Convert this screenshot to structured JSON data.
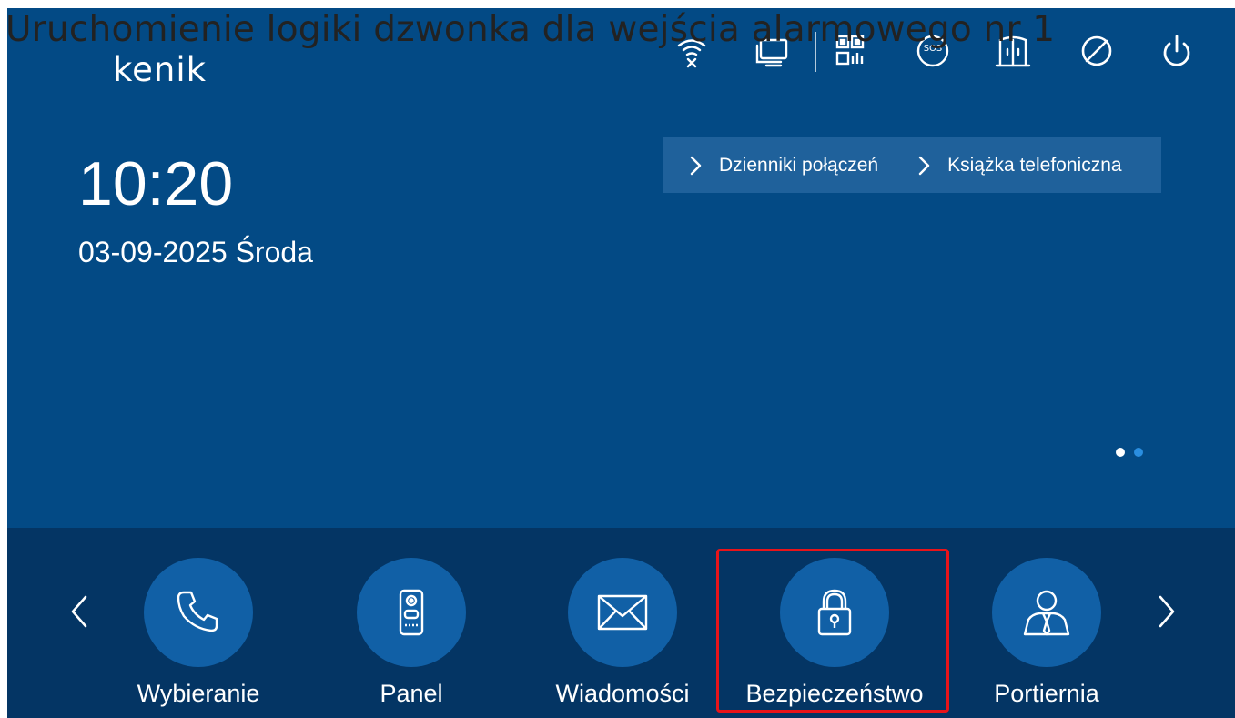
{
  "overlay_title": "Uruchomienie logiki dzwonka dla wejścia alarmowego nr 1",
  "logo": "kenik",
  "time": "10:20",
  "date": "03-09-2025 Środa",
  "quick_links": [
    {
      "label": "Dzienniki połączeń"
    },
    {
      "label": "Książka telefoniczna"
    }
  ],
  "status_icons": [
    "wifi-off-icon",
    "monitor-icon",
    "qr-code-icon",
    "sos-icon",
    "door-icon",
    "do-not-disturb-icon",
    "power-icon"
  ],
  "nav_items": [
    {
      "label": "Wybieranie",
      "icon": "phone-icon"
    },
    {
      "label": "Panel",
      "icon": "door-station-icon"
    },
    {
      "label": "Wiadomości",
      "icon": "envelope-icon"
    },
    {
      "label": "Bezpieczeństwo",
      "icon": "lock-icon",
      "highlighted": true
    },
    {
      "label": "Portiernia",
      "icon": "concierge-icon"
    }
  ],
  "page_indicator": {
    "pages": 2,
    "active": 1
  },
  "colors": {
    "background": "#034a85",
    "bottom_bar": "#043564",
    "icon_circle": "#1160a6",
    "highlight": "#e8141a",
    "dot_active": "#ffffff",
    "dot_inactive": "#2a8ee0"
  }
}
